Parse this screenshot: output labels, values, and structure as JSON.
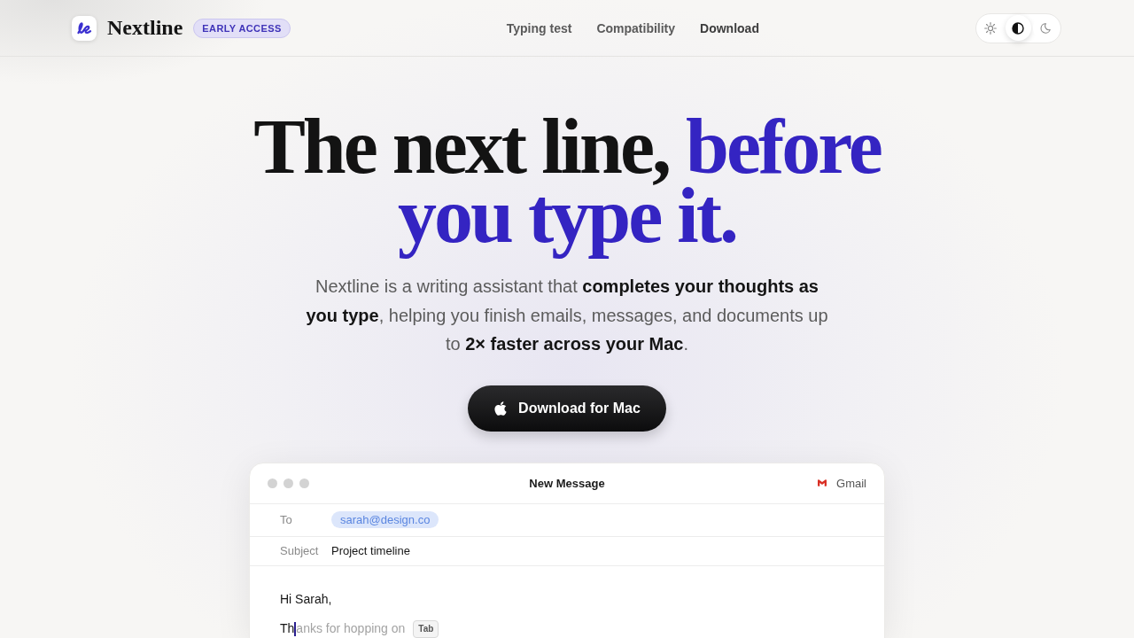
{
  "header": {
    "logo": {
      "name": "Nextline",
      "badge": "EARLY ACCESS"
    },
    "nav": [
      {
        "label": "Typing test",
        "selected": false
      },
      {
        "label": "Compatibility",
        "selected": false
      },
      {
        "label": "Download",
        "selected": true
      }
    ],
    "theme_toggle": [
      {
        "kind": "light",
        "selected": false
      },
      {
        "kind": "system",
        "selected": true
      },
      {
        "kind": "dark",
        "selected": false
      }
    ]
  },
  "hero": {
    "title": {
      "text": "The next line,",
      "accent": "before you type it."
    },
    "subtitle": "Nextline is a writing assistant that **completes your thoughts as you type**, helping you finish emails, messages, and documents up to **2× faster across your Mac**.",
    "cta": {
      "label": "Download for Mac"
    }
  },
  "compose_window": {
    "title": "New Message",
    "app": "Gmail",
    "to": {
      "label": "To",
      "recipients": [
        "sarah@design.co"
      ]
    },
    "subject": {
      "label": "Subject",
      "value": "Project timeline"
    },
    "body": {
      "greeting": "Hi Sarah,",
      "typed": "Th",
      "suggestion": "anks for hopping on",
      "accept_key": "Tab"
    }
  }
}
